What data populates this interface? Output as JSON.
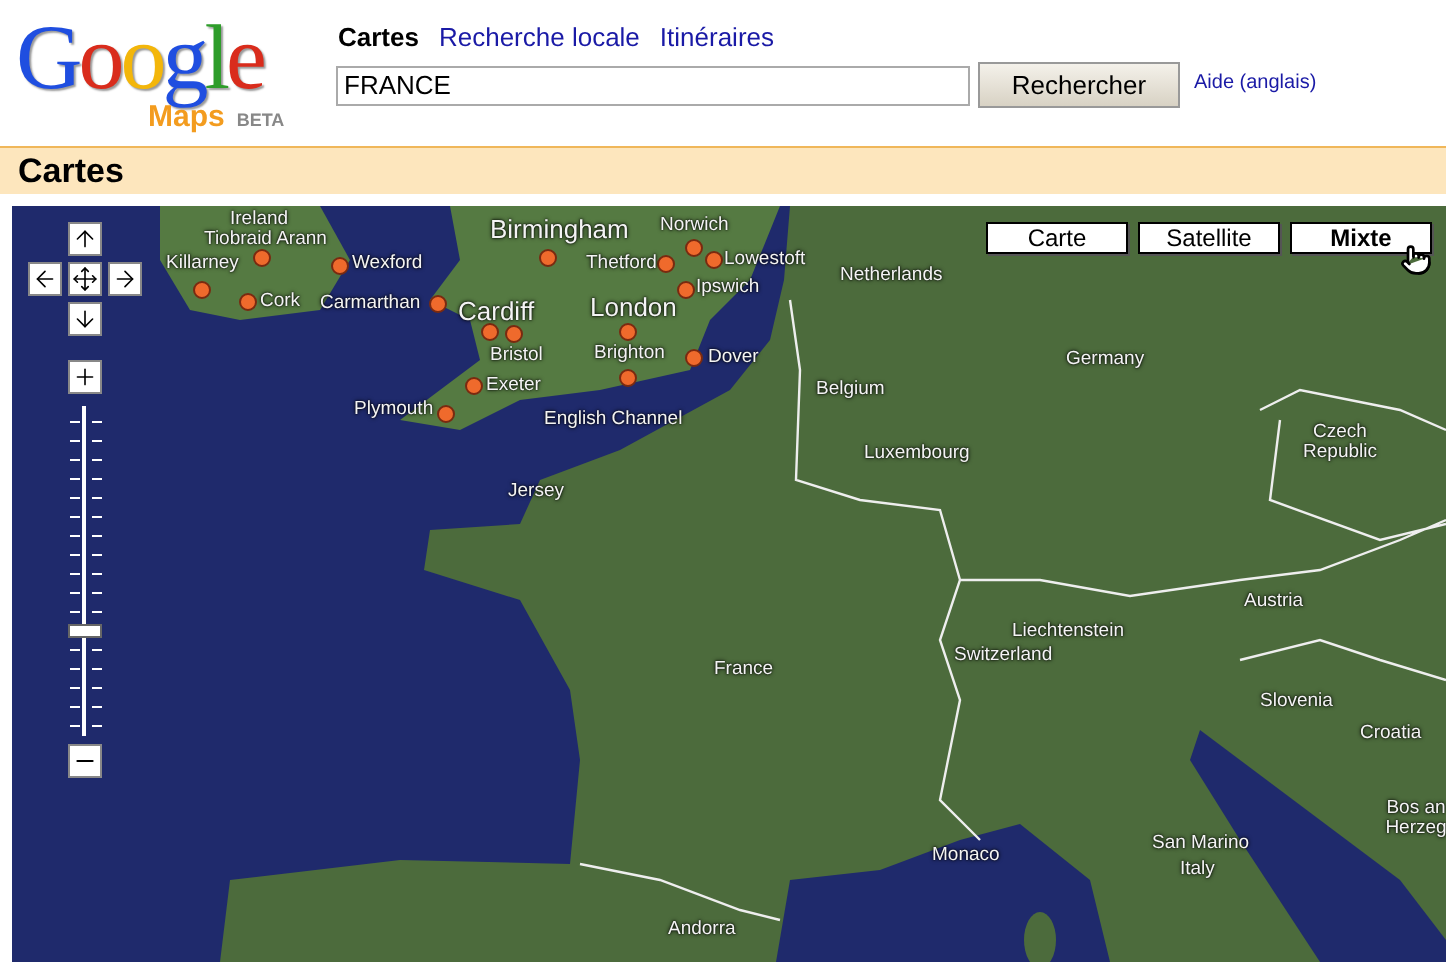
{
  "logo": {
    "wordmark": "Google",
    "product": "Maps",
    "badge": "BETA"
  },
  "nav": [
    {
      "label": "Cartes",
      "selected": true
    },
    {
      "label": "Recherche locale",
      "selected": false
    },
    {
      "label": "Itinéraires",
      "selected": false
    }
  ],
  "search": {
    "value": "FRANCE",
    "button": "Rechercher"
  },
  "help_link": "Aide (anglais)",
  "section_title": "Cartes",
  "map": {
    "types": [
      {
        "label": "Carte",
        "selected": false
      },
      {
        "label": "Satellite",
        "selected": false
      },
      {
        "label": "Mixte",
        "selected": true
      }
    ],
    "zoom": {
      "level": 0.31
    },
    "places": [
      {
        "name": "Ireland",
        "marker": false
      },
      {
        "name": "Birmingham",
        "marker": true,
        "major": true
      },
      {
        "name": "Norwich",
        "marker": true
      },
      {
        "name": "Tiobraid Arann",
        "marker": true
      },
      {
        "name": "Killarney",
        "marker": true
      },
      {
        "name": "Wexford",
        "marker": true
      },
      {
        "name": "Thetford",
        "marker": true
      },
      {
        "name": "Lowestoft",
        "marker": true
      },
      {
        "name": "Netherlands",
        "marker": false
      },
      {
        "name": "Ipswich",
        "marker": true
      },
      {
        "name": "Cork",
        "marker": true
      },
      {
        "name": "Carmarthan",
        "marker": true
      },
      {
        "name": "Cardiff",
        "marker": true,
        "major": true
      },
      {
        "name": "London",
        "marker": true,
        "major": true
      },
      {
        "name": "Bristol",
        "marker": true
      },
      {
        "name": "Brighton",
        "marker": true
      },
      {
        "name": "Dover",
        "marker": true
      },
      {
        "name": "Germany",
        "marker": false
      },
      {
        "name": "Exeter",
        "marker": true
      },
      {
        "name": "Belgium",
        "marker": false
      },
      {
        "name": "Plymouth",
        "marker": true
      },
      {
        "name": "English Channel",
        "marker": false
      },
      {
        "name": "Luxembourg",
        "marker": false
      },
      {
        "name": "Czech Republic",
        "marker": false
      },
      {
        "name": "Jersey",
        "marker": false
      },
      {
        "name": "Austria",
        "marker": false
      },
      {
        "name": "Liechtenstein",
        "marker": false
      },
      {
        "name": "France",
        "marker": false
      },
      {
        "name": "Switzerland",
        "marker": false
      },
      {
        "name": "Slovenia",
        "marker": false
      },
      {
        "name": "Croatia",
        "marker": false
      },
      {
        "name": "Monaco",
        "marker": false
      },
      {
        "name": "San Marino",
        "marker": false
      },
      {
        "name": "Bos an Herzeg",
        "marker": false
      },
      {
        "name": "Italy",
        "marker": false
      },
      {
        "name": "Andorra",
        "marker": false
      }
    ]
  }
}
